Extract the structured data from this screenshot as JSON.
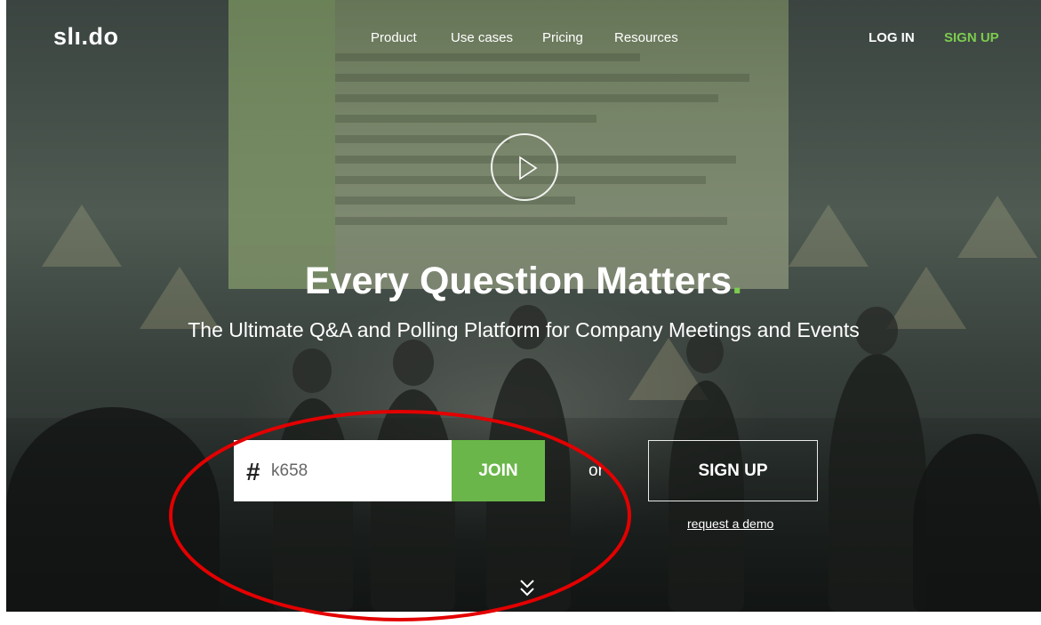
{
  "brand": {
    "logo_text": "slı.do"
  },
  "nav": {
    "items": [
      {
        "label": "Product"
      },
      {
        "label": "Use cases"
      },
      {
        "label": "Pricing"
      },
      {
        "label": "Resources"
      }
    ],
    "login_label": "LOG IN",
    "signup_label": "SIGN UP"
  },
  "hero": {
    "headline": "Every Question Matters",
    "headline_dot": ".",
    "subheadline": "The Ultimate Q&A and Polling Platform for Company Meetings and Events"
  },
  "join": {
    "hash_symbol": "#",
    "event_code_value": "k658",
    "join_label": "JOIN",
    "or_text": "or",
    "signup_label": "SIGN UP",
    "demo_link": "request a demo"
  },
  "icons": {
    "play": "play-icon",
    "scroll": "chevron-double-down-icon"
  },
  "colors": {
    "accent_green": "#6ab64a",
    "nav_signup_green": "#7ccc4f",
    "annotation_red": "#e30000"
  }
}
